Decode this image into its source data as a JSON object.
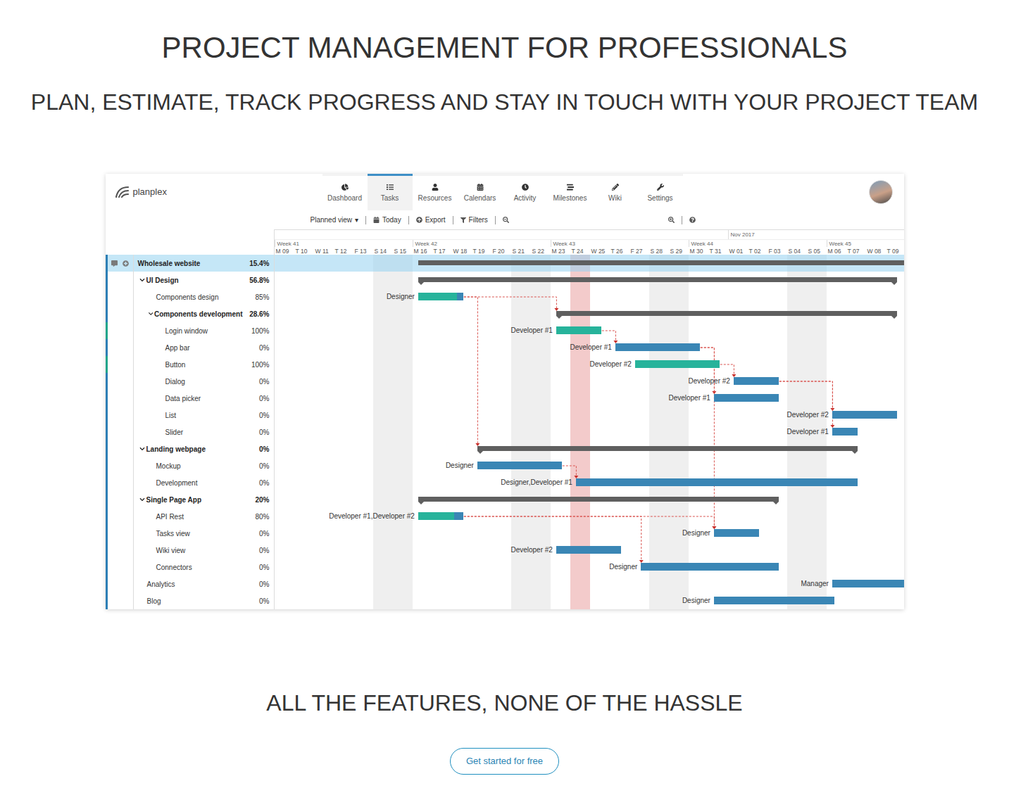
{
  "page": {
    "title": "PROJECT MANAGEMENT FOR PROFESSIONALS",
    "subtitle": "PLAN, ESTIMATE, TRACK PROGRESS AND STAY IN TOUCH WITH YOUR PROJECT TEAM",
    "features_title": "ALL THE FEATURES, NONE OF THE HASSLE",
    "cta": "Get started for free"
  },
  "app": {
    "logo": "planplex",
    "nav": [
      {
        "label": "Dashboard",
        "selected": false
      },
      {
        "label": "Tasks",
        "selected": true
      },
      {
        "label": "Resources",
        "selected": false
      },
      {
        "label": "Calendars",
        "selected": false
      },
      {
        "label": "Activity",
        "selected": false
      },
      {
        "label": "Milestones",
        "selected": false
      },
      {
        "label": "Wiki",
        "selected": false
      },
      {
        "label": "Settings",
        "selected": false
      }
    ],
    "toolbar": {
      "view": "Planned view",
      "caret": "▾",
      "today": "Today",
      "export": "Export",
      "filters": "Filters"
    },
    "timeline": {
      "months": [
        {
          "label": "Nov 2017",
          "from": 23
        }
      ],
      "weeks": [
        {
          "label": "Week 41",
          "days": 7
        },
        {
          "label": "Week 42",
          "days": 7
        },
        {
          "label": "Week 43",
          "days": 7
        },
        {
          "label": "Week 44",
          "days": 7
        },
        {
          "label": "Week 45",
          "days": 4
        }
      ],
      "days": [
        {
          "label": "M 09",
          "weekend": false,
          "today": false
        },
        {
          "label": "T 10",
          "weekend": false,
          "today": false
        },
        {
          "label": "W 11",
          "weekend": false,
          "today": false
        },
        {
          "label": "T 12",
          "weekend": false,
          "today": false
        },
        {
          "label": "F 13",
          "weekend": false,
          "today": false
        },
        {
          "label": "S 14",
          "weekend": true,
          "today": false
        },
        {
          "label": "S 15",
          "weekend": true,
          "today": false
        },
        {
          "label": "M 16",
          "weekend": false,
          "today": false
        },
        {
          "label": "T 17",
          "weekend": false,
          "today": false
        },
        {
          "label": "W 18",
          "weekend": false,
          "today": false
        },
        {
          "label": "T 19",
          "weekend": false,
          "today": false
        },
        {
          "label": "F 20",
          "weekend": false,
          "today": false
        },
        {
          "label": "S 21",
          "weekend": true,
          "today": false
        },
        {
          "label": "S 22",
          "weekend": true,
          "today": false
        },
        {
          "label": "M 23",
          "weekend": false,
          "today": false
        },
        {
          "label": "T 24",
          "weekend": false,
          "today": true
        },
        {
          "label": "W 25",
          "weekend": false,
          "today": false
        },
        {
          "label": "T 26",
          "weekend": false,
          "today": false
        },
        {
          "label": "F 27",
          "weekend": false,
          "today": false
        },
        {
          "label": "S 28",
          "weekend": true,
          "today": false
        },
        {
          "label": "S 29",
          "weekend": true,
          "today": false
        },
        {
          "label": "M 30",
          "weekend": false,
          "today": false
        },
        {
          "label": "T 31",
          "weekend": false,
          "today": false
        },
        {
          "label": "W 01",
          "weekend": false,
          "today": false
        },
        {
          "label": "T 02",
          "weekend": false,
          "today": false
        },
        {
          "label": "F 03",
          "weekend": false,
          "today": false
        },
        {
          "label": "S 04",
          "weekend": true,
          "today": false
        },
        {
          "label": "S 05",
          "weekend": true,
          "today": false
        },
        {
          "label": "M 06",
          "weekend": false,
          "today": false
        },
        {
          "label": "T 07",
          "weekend": false,
          "today": false
        },
        {
          "label": "W 08",
          "weekend": false,
          "today": false
        },
        {
          "label": "T 09",
          "weekend": false,
          "today": false
        }
      ]
    },
    "rows": [
      {
        "name": "Wholesale website",
        "percent": "15.4%",
        "depth": 0,
        "kind": "project",
        "expanded": true,
        "selected": true,
        "color": "#2d7fb5",
        "bar": {
          "start": 7.3,
          "days": 25
        }
      },
      {
        "name": "UI Design",
        "percent": "56.8%",
        "depth": 1,
        "kind": "group",
        "expanded": true,
        "selected": false,
        "color": "#2d7fb5",
        "bar": {
          "start": 7.3,
          "days": 24.3
        }
      },
      {
        "name": "Components design",
        "percent": "85%",
        "depth": 2,
        "kind": "task",
        "expanded": false,
        "selected": false,
        "color": "#2d7fb5",
        "bar": {
          "start": 7.3,
          "days": 2.3,
          "level": 0.85,
          "label": "Designer"
        }
      },
      {
        "name": "Components development",
        "percent": "28.6%",
        "depth": 2,
        "kind": "group",
        "expanded": true,
        "selected": false,
        "color": "#2d7fb5",
        "bar": {
          "start": 14.3,
          "days": 17.3
        }
      },
      {
        "name": "Login window",
        "percent": "100%",
        "depth": 3,
        "kind": "task",
        "expanded": false,
        "selected": false,
        "color": "#22a58b",
        "bar": {
          "start": 14.3,
          "days": 2.3,
          "level": 1,
          "label": "Developer #1"
        }
      },
      {
        "name": "App bar",
        "percent": "0%",
        "depth": 3,
        "kind": "task",
        "expanded": false,
        "selected": false,
        "color": "#2d7fb5",
        "bar": {
          "start": 17.3,
          "days": 4.3,
          "level": 0,
          "label": "Developer #1"
        }
      },
      {
        "name": "Button",
        "percent": "100%",
        "depth": 3,
        "kind": "task",
        "expanded": false,
        "selected": false,
        "color": "#22a58b",
        "bar": {
          "start": 18.3,
          "days": 4.3,
          "level": 1,
          "label": "Developer #2"
        }
      },
      {
        "name": "Dialog",
        "percent": "0%",
        "depth": 3,
        "kind": "task",
        "expanded": false,
        "selected": false,
        "color": "#2d7fb5",
        "bar": {
          "start": 23.3,
          "days": 2.3,
          "level": 0,
          "label": "Developer #2"
        }
      },
      {
        "name": "Data picker",
        "percent": "0%",
        "depth": 3,
        "kind": "task",
        "expanded": false,
        "selected": false,
        "color": "#2d7fb5",
        "bar": {
          "start": 22.3,
          "days": 3.3,
          "level": 0,
          "label": "Developer #1"
        }
      },
      {
        "name": "List",
        "percent": "0%",
        "depth": 3,
        "kind": "task",
        "expanded": false,
        "selected": false,
        "color": "#2d7fb5",
        "bar": {
          "start": 28.3,
          "days": 3.3,
          "level": 0,
          "label": "Developer #2"
        }
      },
      {
        "name": "Slider",
        "percent": "0%",
        "depth": 3,
        "kind": "task",
        "expanded": false,
        "selected": false,
        "color": "#2d7fb5",
        "bar": {
          "start": 28.3,
          "days": 1.3,
          "level": 0,
          "label": "Developer #1"
        }
      },
      {
        "name": "Landing webpage",
        "percent": "0%",
        "depth": 1,
        "kind": "group",
        "expanded": true,
        "selected": false,
        "color": "#2d7fb5",
        "bar": {
          "start": 10.3,
          "days": 19.3
        }
      },
      {
        "name": "Mockup",
        "percent": "0%",
        "depth": 2,
        "kind": "task",
        "expanded": false,
        "selected": false,
        "color": "#2d7fb5",
        "bar": {
          "start": 10.3,
          "days": 4.3,
          "level": 0,
          "label": "Designer"
        }
      },
      {
        "name": "Development",
        "percent": "0%",
        "depth": 2,
        "kind": "task",
        "expanded": false,
        "selected": false,
        "color": "#2d7fb5",
        "bar": {
          "start": 15.3,
          "days": 14.3,
          "level": 0,
          "label": "Designer,Developer #1"
        }
      },
      {
        "name": "Single Page App",
        "percent": "20%",
        "depth": 1,
        "kind": "group",
        "expanded": true,
        "selected": false,
        "color": "#2d7fb5",
        "bar": {
          "start": 7.3,
          "days": 18.3
        }
      },
      {
        "name": "API Rest",
        "percent": "80%",
        "depth": 2,
        "kind": "task",
        "expanded": false,
        "selected": false,
        "color": "#2d7fb5",
        "bar": {
          "start": 7.3,
          "days": 2.3,
          "level": 0.8,
          "label": "Developer #1,Developer #2"
        }
      },
      {
        "name": "Tasks view",
        "percent": "0%",
        "depth": 2,
        "kind": "task",
        "expanded": false,
        "selected": false,
        "color": "#2d7fb5",
        "bar": {
          "start": 22.3,
          "days": 2.3,
          "level": 0,
          "label": "Designer"
        }
      },
      {
        "name": "Wiki view",
        "percent": "0%",
        "depth": 2,
        "kind": "task",
        "expanded": false,
        "selected": false,
        "color": "#2d7fb5",
        "bar": {
          "start": 14.3,
          "days": 3.3,
          "level": 0,
          "label": "Developer #2"
        }
      },
      {
        "name": "Connectors",
        "percent": "0%",
        "depth": 2,
        "kind": "task",
        "expanded": false,
        "selected": false,
        "color": "#2d7fb5",
        "bar": {
          "start": 18.6,
          "days": 7,
          "level": 0,
          "label": "Designer"
        }
      },
      {
        "name": "Analytics",
        "percent": "0%",
        "depth": 1,
        "kind": "task",
        "expanded": false,
        "selected": false,
        "color": "#2d7fb5",
        "bar": {
          "start": 28.3,
          "days": 4,
          "level": 0,
          "label": "Manager"
        }
      },
      {
        "name": "Blog",
        "percent": "0%",
        "depth": 1,
        "kind": "task",
        "expanded": false,
        "selected": false,
        "color": "#2d7fb5",
        "bar": {
          "start": 22.3,
          "days": 6.1,
          "level": 0,
          "label": "Designer"
        }
      }
    ],
    "links": [
      [
        2,
        3
      ],
      [
        2,
        11
      ],
      [
        4,
        5
      ],
      [
        5,
        8
      ],
      [
        5,
        16
      ],
      [
        6,
        7
      ],
      [
        7,
        9
      ],
      [
        7,
        10
      ],
      [
        12,
        13
      ],
      [
        15,
        18
      ],
      [
        15,
        16
      ]
    ]
  }
}
